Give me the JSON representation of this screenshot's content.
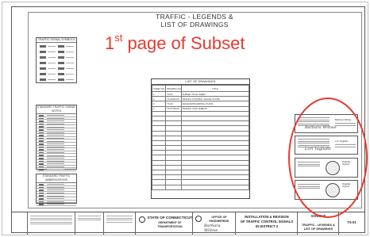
{
  "sheet_title": {
    "line1": "TRAFFIC - LEGENDS &",
    "line2": "LIST OF DRAWINGS"
  },
  "overlay": {
    "label_num": "1",
    "label_sup": "st",
    "label_rest": " page of Subset",
    "color": "#e53a2f"
  },
  "legends": {
    "top_title": "TRAFFIC SIGNAL SYMBOLS",
    "mid_title": "STANDARD TRAFFIC SIGNAL NOTES",
    "bottom_title": "STANDARD TRAFFIC ABBREVIATIONS"
  },
  "list_of_drawings": {
    "title": "LIST OF DRAWINGS",
    "headers": [
      "SHEET NO.",
      "DRAWING NO.",
      "TITLE"
    ],
    "rows": [
      [
        "1",
        "TS-01",
        "SUBSET TITLE SHEET"
      ],
      [
        "2",
        "TS-02/03-05",
        "TRAFFIC CONTROL SIGNAL PLANS"
      ],
      [
        "3",
        "TS-06",
        "DIAGRAM BOARDING PLANS"
      ],
      [
        "4",
        "TS-07/08-09",
        "TRAFFIC SIGN SHEETS"
      ]
    ]
  },
  "stamps": {
    "signer_1": "Barbara Wiltsie",
    "signer_2": "Lori Tagliatti",
    "sig_1": "Barbara Wiltsie",
    "sig_2": "Lori Tagliatti",
    "seal_text": "Digitally signed"
  },
  "title_block": {
    "agency_1": "STATE OF CONNECTICUT",
    "agency_2": "DEPARTMENT OF TRANSPORTATION",
    "office_1": "OFFICE OF ENGINEERING",
    "project_1": "INSTALLATION & REVISION",
    "project_2": "OF TRAFFIC CONTROL SIGNALS",
    "project_3": "IN DISTRICT 3",
    "town": "VARIOUS",
    "sheet_name_1": "TRAFFIC - LEGENDS &",
    "sheet_name_2": "LIST OF DRAWINGS",
    "drawing_no": "TS-01"
  }
}
